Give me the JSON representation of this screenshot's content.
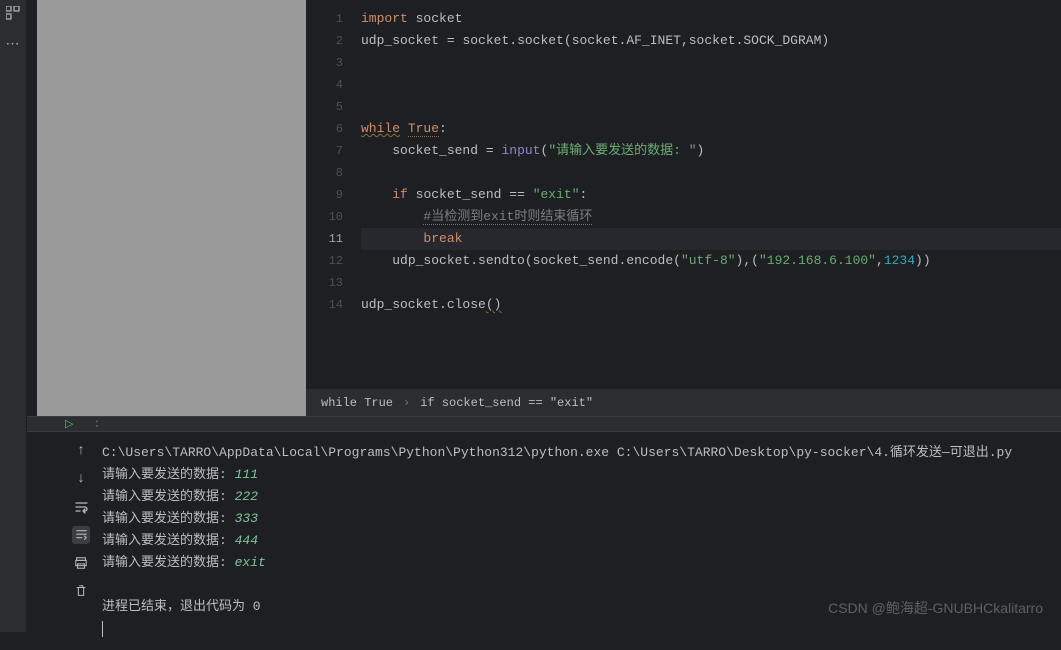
{
  "editor": {
    "lines": [
      {
        "n": 1,
        "html": "<span class='k-kw'>import</span> <span class='k-id'>socket</span>"
      },
      {
        "n": 2,
        "html": "<span class='k-id'>udp_socket</span> <span class='k-op'>=</span> <span class='k-id'>socket</span><span class='k-punc'>.</span><span class='k-id'>socket</span><span class='k-punc'>(</span><span class='k-id'>socket</span><span class='k-punc'>.</span><span class='k-id'>AF_INET</span><span class='k-punc'>,</span><span class='k-id'>socket</span><span class='k-punc'>.</span><span class='k-id'>SOCK_DGRAM</span><span class='k-punc'>)</span>"
      },
      {
        "n": 3,
        "html": ""
      },
      {
        "n": 4,
        "html": ""
      },
      {
        "n": 5,
        "html": ""
      },
      {
        "n": 6,
        "html": "<span class='k-kw wavy'>while</span> <span class='k-kw dotted-u'>True</span><span class='k-punc'>:</span>"
      },
      {
        "n": 7,
        "html": "    <span class='k-id'>socket_send</span> <span class='k-op'>=</span> <span class='k-builtin'>input</span><span class='k-punc'>(</span><span class='k-str'>\"请输入要发送的数据: \"</span><span class='k-punc'>)</span>"
      },
      {
        "n": 8,
        "html": ""
      },
      {
        "n": 9,
        "html": "    <span class='k-kw'>if</span> <span class='k-id'>socket_send</span> <span class='k-op'>==</span> <span class='k-str'>\"exit\"</span><span class='k-punc'>:</span>"
      },
      {
        "n": 10,
        "html": "        <span class='k-cmt dotted-u'>#当检测到exit时则结束循环</span>"
      },
      {
        "n": 11,
        "html": "        <span class='k-kw'>break</span>",
        "hl": true,
        "current": true
      },
      {
        "n": 12,
        "html": "    <span class='k-id'>udp_socket</span><span class='k-punc'>.</span><span class='k-id'>sendto</span><span class='k-punc'>(</span><span class='k-id'>socket_send</span><span class='k-punc'>.</span><span class='k-id'>encode</span><span class='k-punc'>(</span><span class='k-str'>\"utf-8\"</span><span class='k-punc'>)</span><span class='k-punc'>,(</span><span class='k-str'>\"192.168.6.100\"</span><span class='k-punc'>,</span><span class='k-num'>1234</span><span class='k-punc'>))</span>"
      },
      {
        "n": 13,
        "html": ""
      },
      {
        "n": 14,
        "html": "<span class='k-id'>udp_socket</span><span class='k-punc'>.</span><span class='k-id'>close</span><span class='k-punc wavy'>()</span>"
      }
    ]
  },
  "breadcrumb": {
    "item1": "while True",
    "sep": "›",
    "item2": "if socket_send == \"exit\""
  },
  "terminal": {
    "cmd": "C:\\Users\\TARRO\\AppData\\Local\\Programs\\Python\\Python312\\python.exe C:\\Users\\TARRO\\Desktop\\py-socker\\4.循环发送—可退出.py",
    "lines": [
      {
        "prompt": "请输入要发送的数据: ",
        "input": "111"
      },
      {
        "prompt": "请输入要发送的数据: ",
        "input": "222"
      },
      {
        "prompt": "请输入要发送的数据: ",
        "input": "333"
      },
      {
        "prompt": "请输入要发送的数据: ",
        "input": "444"
      },
      {
        "prompt": "请输入要发送的数据: ",
        "input": "exit"
      }
    ],
    "exit_msg": "进程已结束，退出代码为 0"
  },
  "watermark": "CSDN @鲍海超-GNUBHCkalitarro"
}
